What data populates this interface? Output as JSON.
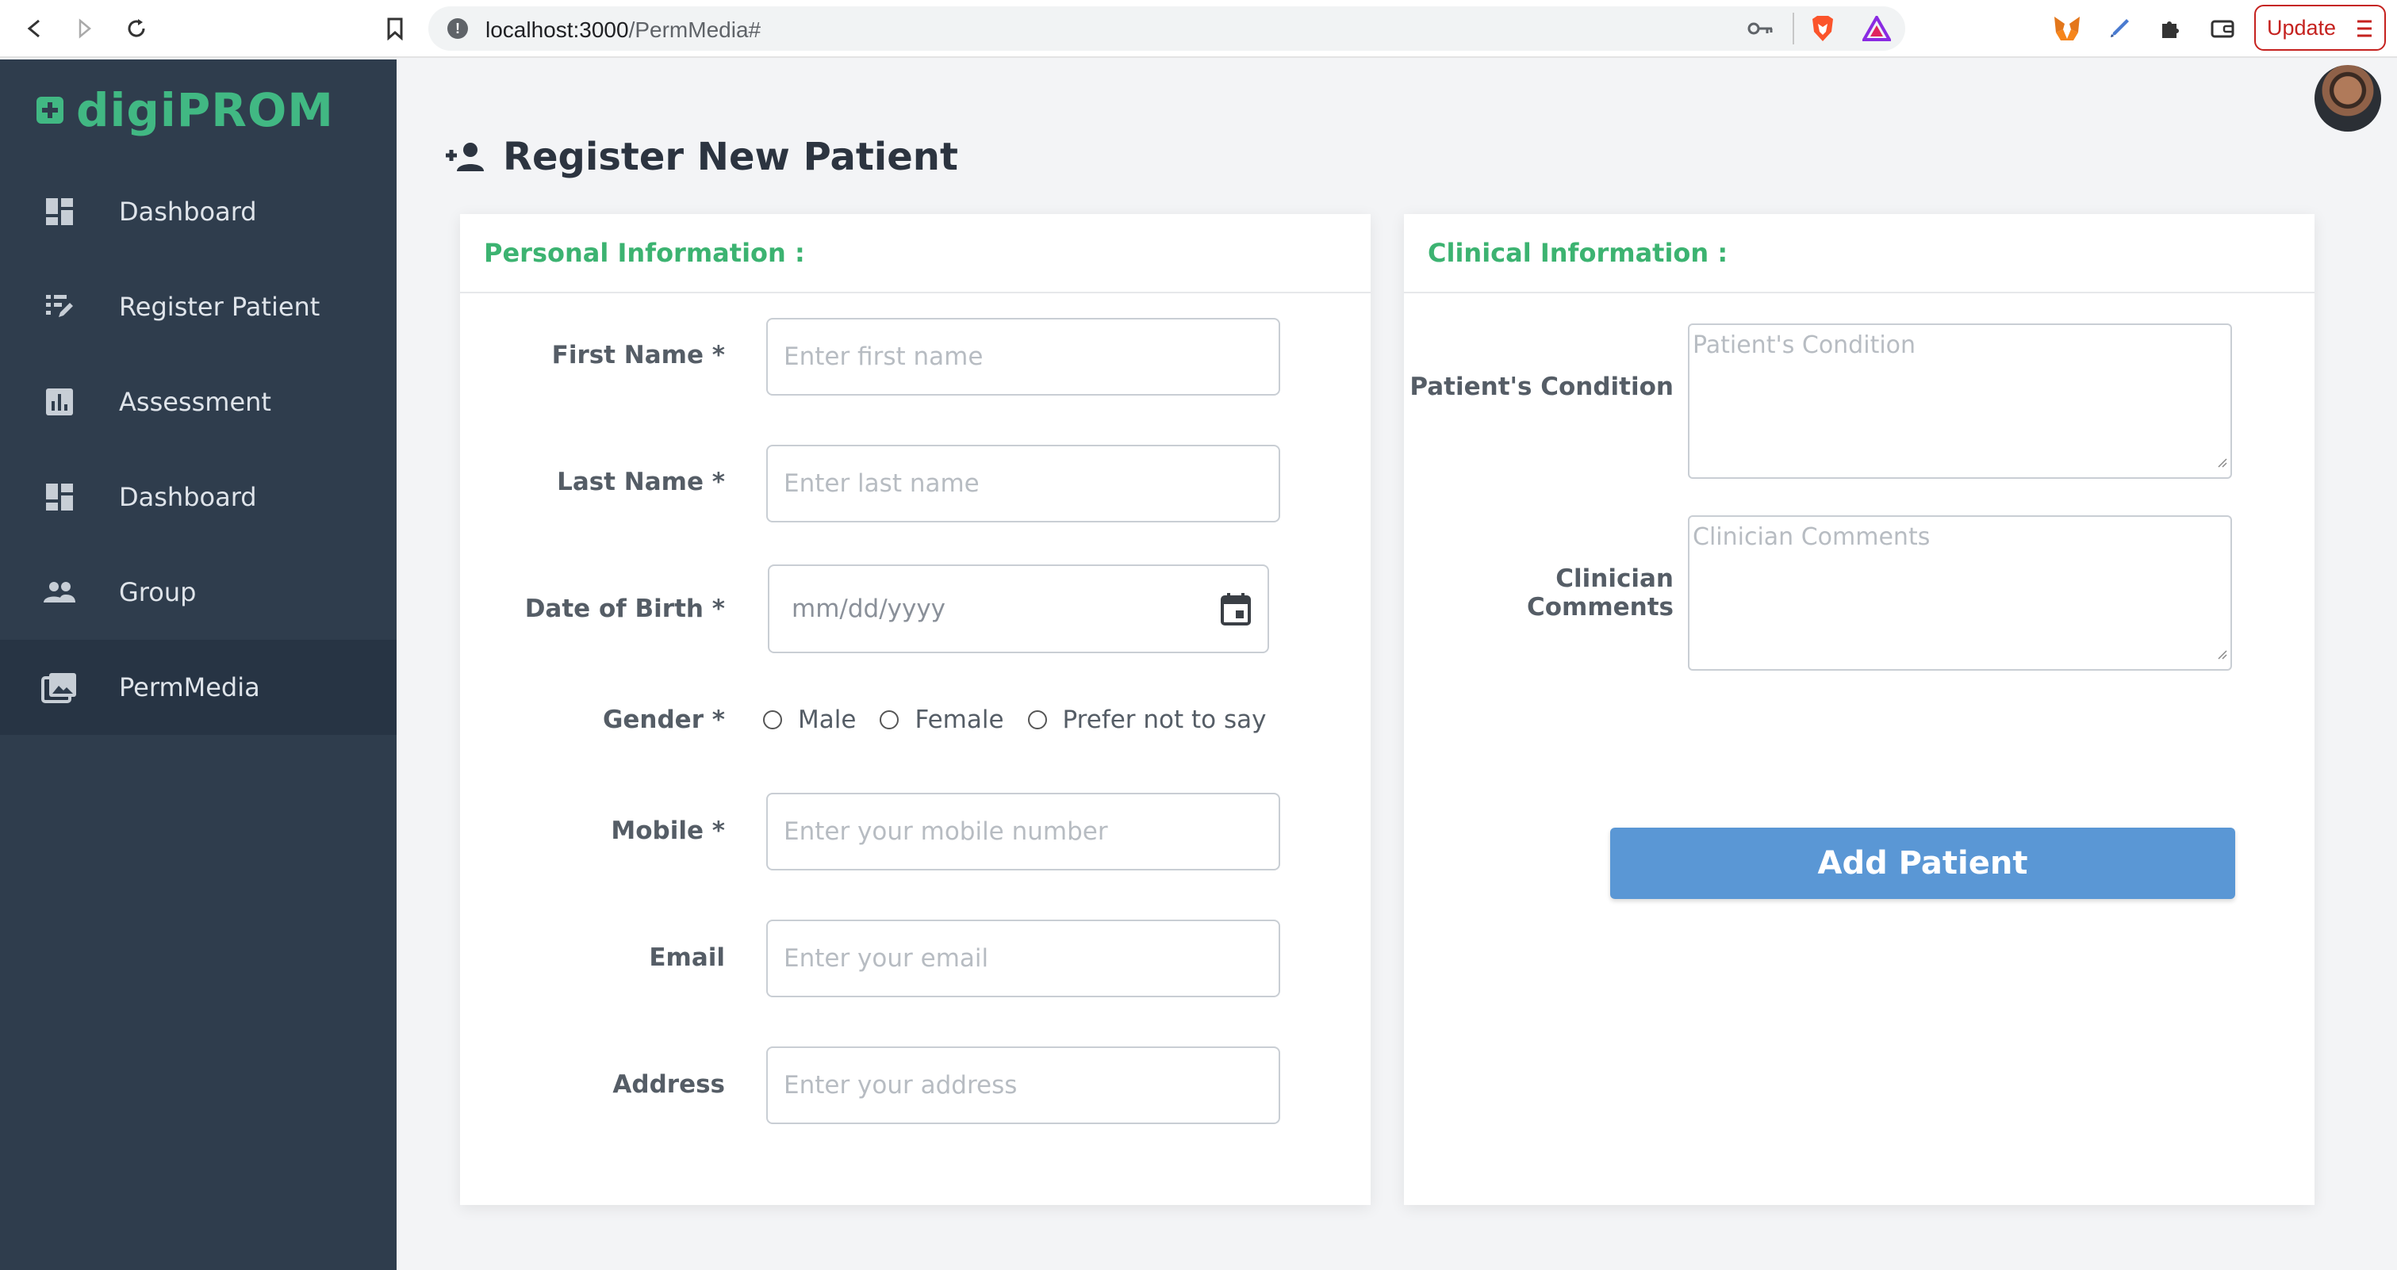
{
  "browser": {
    "url_host": "localhost:3000",
    "url_path": "/PermMedia#",
    "update_label": "Update",
    "icons": [
      "back-icon",
      "forward-icon",
      "reload-icon",
      "bookmark-icon",
      "info-icon",
      "key-icon",
      "brave-icon",
      "triangle-icon",
      "metamask-icon",
      "pen-icon",
      "puzzle-icon",
      "wallet-icon",
      "menu-icon"
    ]
  },
  "sidebar": {
    "logo": "digiPROM",
    "items": [
      {
        "label": "Dashboard",
        "icon": "dashboard-icon"
      },
      {
        "label": "Register Patient",
        "icon": "register-icon"
      },
      {
        "label": "Assessment",
        "icon": "chart-icon"
      },
      {
        "label": "Dashboard",
        "icon": "dashboard-icon"
      },
      {
        "label": "Group",
        "icon": "group-icon"
      },
      {
        "label": "PermMedia",
        "icon": "media-icon"
      }
    ],
    "active_index": 5
  },
  "page": {
    "title": "Register New Patient"
  },
  "personal": {
    "heading": "Personal Information :",
    "first_name_label": "First Name *",
    "first_name_placeholder": "Enter first name",
    "last_name_label": "Last Name *",
    "last_name_placeholder": "Enter last name",
    "dob_label": "Date of Birth *",
    "dob_placeholder": "mm/dd/yyyy",
    "gender_label": "Gender *",
    "gender_options": [
      "Male",
      "Female",
      "Prefer not to say"
    ],
    "mobile_label": "Mobile *",
    "mobile_placeholder": "Enter your mobile number",
    "email_label": "Email",
    "email_placeholder": "Enter your email",
    "address_label": "Address",
    "address_placeholder": "Enter your address"
  },
  "clinical": {
    "heading": "Clinical Information :",
    "condition_label": "Patient's Condition",
    "condition_placeholder": "Patient's Condition",
    "comments_label": "Clinician Comments",
    "comments_placeholder": "Clinician Comments",
    "submit_label": "Add Patient"
  },
  "colors": {
    "sidebar_bg": "#2f3d4d",
    "sidebar_active": "#273444",
    "brand_green": "#41b883",
    "heading_green": "#3cb371",
    "button_blue": "#5a97d5"
  }
}
